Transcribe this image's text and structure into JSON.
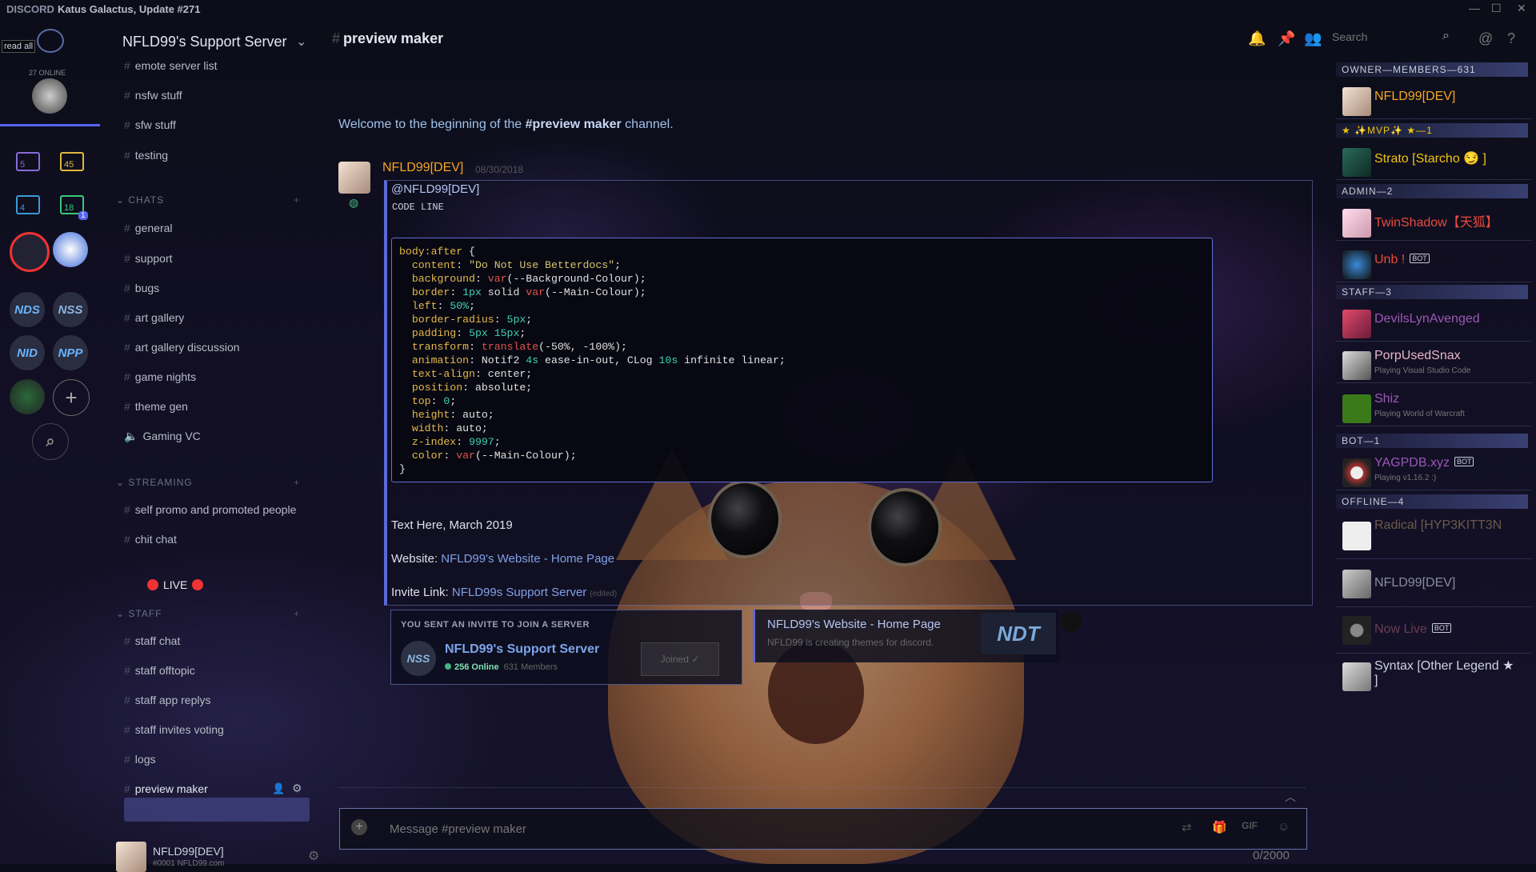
{
  "titlebar": {
    "brand": "DISCORD",
    "version": "Katus Galactus, Update #271"
  },
  "guilds": {
    "read_all": "read all",
    "online_count": "27 ONLINE",
    "folders": [
      "5",
      "45",
      "4",
      "18"
    ],
    "folder_badge": "1",
    "icons": [
      "NDS",
      "NSS",
      "NID",
      "NPP"
    ],
    "add": "+"
  },
  "server": {
    "name": "NFLD99's Support Server",
    "channels_top": [
      "emote server list",
      "nsfw stuff",
      "sfw stuff",
      "testing"
    ],
    "chats_label": "CHATS",
    "chats": [
      "general",
      "support",
      "bugs",
      "art gallery",
      "art gallery discussion",
      "game nights",
      "theme gen",
      "Gaming VC"
    ],
    "streaming_label": "STREAMING",
    "streaming": [
      "self promo and promoted people",
      "chit chat"
    ],
    "live": "LIVE",
    "staff_label": "STAFF",
    "staff": [
      "staff chat",
      "staff offtopic",
      "staff app replys",
      "staff invites voting",
      "logs",
      "preview maker"
    ]
  },
  "user": {
    "name": "NFLD99[DEV]",
    "tag": "#0001  NFLD99.com"
  },
  "header": {
    "channel": "preview maker",
    "search_placeholder": "Search"
  },
  "chat": {
    "welcome_pre": "Welcome to the beginning of the ",
    "welcome_chan": "#preview maker",
    "welcome_post": " channel.",
    "author": "NFLD99[DEV]",
    "time": "08/30/2018",
    "mention": "@NFLD99[DEV]",
    "code_label": "CODE LINE",
    "text_line": "Text Here, March 2019",
    "website_label": "Website: ",
    "website_link": "NFLD99's Website - Home Page",
    "invite_label": "Invite Link: ",
    "invite_link": "NFLD99s Support Server",
    "edited": "(edited)"
  },
  "invite": {
    "label": "YOU SENT AN INVITE TO JOIN A SERVER",
    "icon": "NSS",
    "server": "NFLD99's Support Server",
    "online": "256 Online",
    "members": "631 Members",
    "button": "Joined"
  },
  "link_embed": {
    "title": "NFLD99's Website - Home Page",
    "desc": "NFLD99 is creating themes for discord.",
    "logo": "NDT"
  },
  "composer": {
    "placeholder": "Message #preview maker",
    "counter": "0/2000"
  },
  "members": {
    "roles": [
      "OWNER—MEMBERS—631",
      "★ ✨MVP✨ ★—1",
      "ADMIN—2",
      "STAFF—3",
      "BOT—1",
      "OFFLINE—4"
    ],
    "list": [
      {
        "name": "NFLD99[DEV]",
        "color": "#f5a623"
      },
      {
        "name": "Strato [Starcho 😏 ]",
        "color": "#f1c40f"
      },
      {
        "name": "TwinShadow【天狐】",
        "color": "#e74c3c"
      },
      {
        "name": "Unb !",
        "color": "#e74c3c",
        "bot": "BOT"
      },
      {
        "name": "DevilsLynAvenged",
        "color": "#9b59b6"
      },
      {
        "name": "PorpUsedSnax",
        "color": "#e8b7c8",
        "sub": "Playing Visual Studio Code"
      },
      {
        "name": "Shiz",
        "color": "#9b59b6",
        "sub": "Playing World of Warcraft"
      },
      {
        "name": "YAGPDB.xyz",
        "color": "#9b59b6",
        "bot": "BOT",
        "sub": "Playing v1.16.2 :)"
      },
      {
        "name": "Radical [HYP3KITT3N",
        "color": "#6b5a4a"
      },
      {
        "name": "NFLD99[DEV]",
        "color": "#8a8d99"
      },
      {
        "name": "Now Live",
        "color": "#6b3e54",
        "bot": "BOT"
      },
      {
        "name": "Syntax [Other Legend ★ ]",
        "color": "#cfd2e0"
      }
    ]
  }
}
